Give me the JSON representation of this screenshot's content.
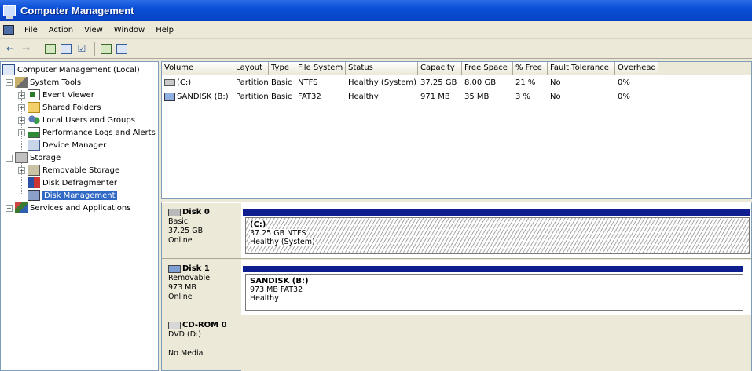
{
  "window": {
    "title": "Computer Management"
  },
  "menu": [
    "File",
    "Action",
    "View",
    "Window",
    "Help"
  ],
  "toolbar": {
    "icons": [
      "back-arrow-icon",
      "forward-arrow-icon",
      "up-folder-icon",
      "show-hide-tree-icon",
      "properties-icon",
      "refresh-icon",
      "help-icon"
    ]
  },
  "tree": {
    "root": "Computer Management (Local)",
    "system_tools": "System Tools",
    "event_viewer": "Event Viewer",
    "shared_folders": "Shared Folders",
    "local_users": "Local Users and Groups",
    "perf_logs": "Performance Logs and Alerts",
    "device_manager": "Device Manager",
    "storage": "Storage",
    "removable_storage": "Removable Storage",
    "defragmenter": "Disk Defragmenter",
    "disk_management": "Disk Management",
    "services": "Services and Applications"
  },
  "volumes": {
    "columns": [
      "Volume",
      "Layout",
      "Type",
      "File System",
      "Status",
      "Capacity",
      "Free Space",
      "% Free",
      "Fault Tolerance",
      "Overhead"
    ],
    "rows": [
      [
        "(C:)",
        "Partition",
        "Basic",
        "NTFS",
        "Healthy (System)",
        "37.25 GB",
        "8.00 GB",
        "21 %",
        "No",
        "0%"
      ],
      [
        "SANDISK (B:)",
        "Partition",
        "Basic",
        "FAT32",
        "Healthy",
        "971 MB",
        "35 MB",
        "3 %",
        "No",
        "0%"
      ]
    ]
  },
  "disks": {
    "disk0": {
      "name": "Disk 0",
      "type": "Basic",
      "size": "37.25 GB",
      "state": "Online",
      "part_title": "(C:)",
      "part_size": "37.25 GB NTFS",
      "part_status": "Healthy (System)"
    },
    "disk1": {
      "name": "Disk 1",
      "type": "Removable",
      "size": "973 MB",
      "state": "Online",
      "part_title": "SANDISK  (B:)",
      "part_size": "973 MB FAT32",
      "part_status": "Healthy"
    },
    "cdrom0": {
      "name": "CD-ROM 0",
      "type": "DVD (D:)",
      "state": "No Media"
    }
  },
  "colors": {
    "title_bar": "#0a4fd6",
    "selection": "#316ac5",
    "partition_bar": "#0f1e8e"
  }
}
